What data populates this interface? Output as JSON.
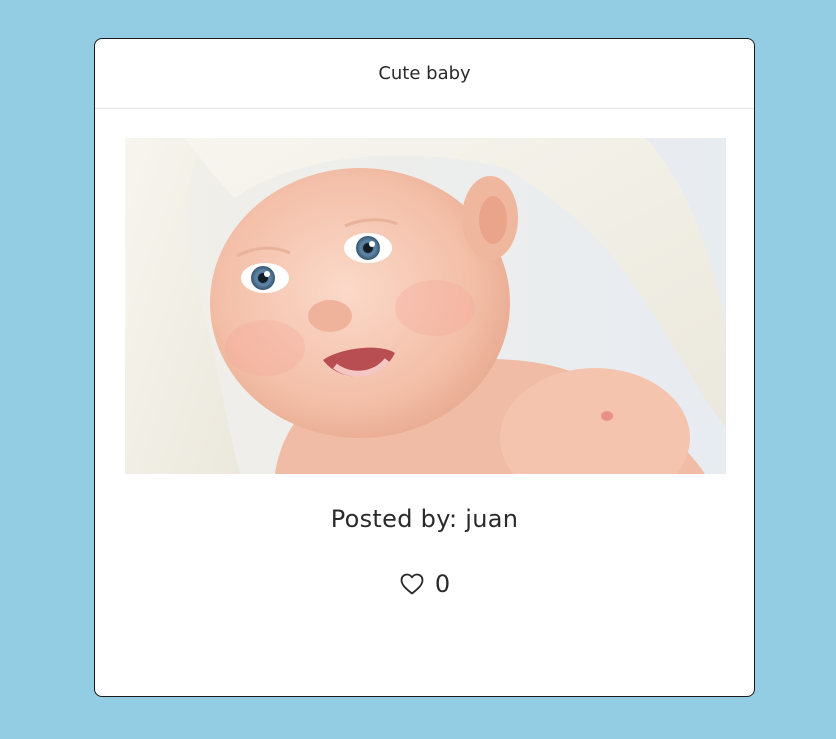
{
  "post": {
    "title": "Cute baby",
    "posted_by": "Posted by: juan",
    "likes": "0",
    "image_alt": "Cute baby",
    "icon": "heart-outline-icon"
  },
  "colors": {
    "page_background": "#92cde3",
    "card_background": "#ffffff",
    "text": "#2a2a2a"
  }
}
